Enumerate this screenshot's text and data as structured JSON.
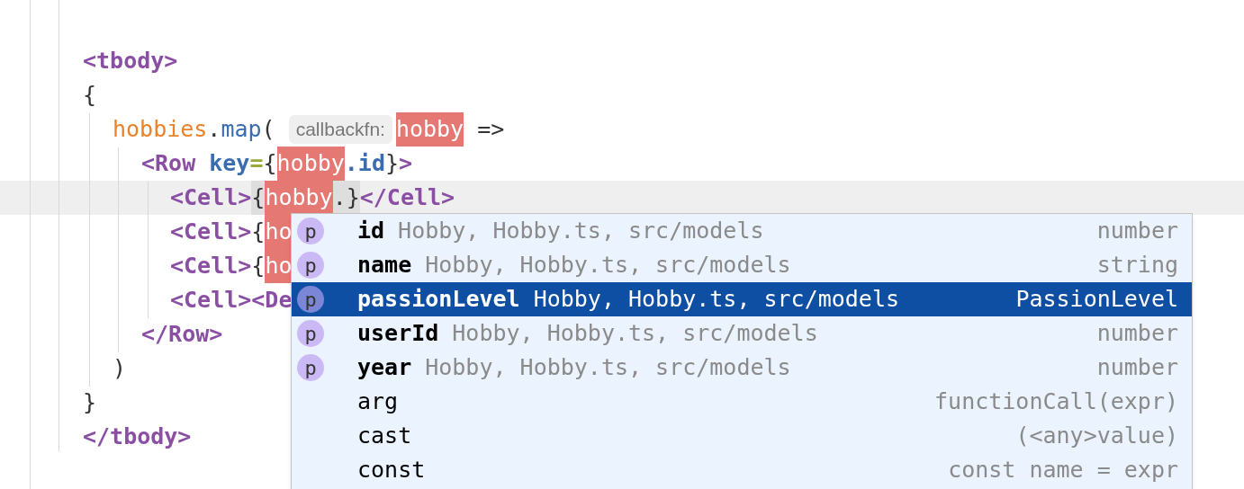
{
  "code_lines": [
    {
      "current": false,
      "tokens": [
        {
          "kind": "tag",
          "text": "<tbody>"
        }
      ]
    },
    {
      "current": false,
      "tokens": [
        {
          "kind": "punct",
          "text": "{"
        }
      ],
      "children": [
        {
          "current": false,
          "tokens": [
            {
              "kind": "variable",
              "text": "hobbies"
            },
            {
              "kind": "punct",
              "text": "."
            },
            {
              "kind": "method",
              "text": "map"
            },
            {
              "kind": "punct",
              "text": "( "
            },
            {
              "kind": "hint",
              "text": "callbackfn:"
            },
            {
              "kind": "match",
              "text": "hobby"
            },
            {
              "kind": "punct",
              "text": " =>"
            }
          ],
          "children": [
            {
              "current": false,
              "tokens": [
                {
                  "kind": "tag",
                  "text": "<Row "
                },
                {
                  "kind": "attr",
                  "text": "key"
                },
                {
                  "kind": "equals",
                  "text": "="
                },
                {
                  "kind": "punct",
                  "text": "{"
                },
                {
                  "kind": "match",
                  "text": "hobby"
                },
                {
                  "kind": "property",
                  "text": ".id"
                },
                {
                  "kind": "punct",
                  "text": "}"
                },
                {
                  "kind": "tag",
                  "text": ">"
                }
              ],
              "children": [
                {
                  "current": true,
                  "tokens": [
                    {
                      "kind": "tag",
                      "text": "<Cell>"
                    },
                    {
                      "kind": "brace",
                      "text": "{"
                    },
                    {
                      "kind": "match",
                      "text": "hobby"
                    },
                    {
                      "kind": "brace",
                      "text": ".}"
                    },
                    {
                      "kind": "tag",
                      "text": "</Cell>"
                    }
                  ]
                },
                {
                  "current": false,
                  "tokens": [
                    {
                      "kind": "tag",
                      "text": "<Cell>"
                    },
                    {
                      "kind": "punct",
                      "text": "{"
                    },
                    {
                      "kind": "match",
                      "text": "ho"
                    }
                  ]
                },
                {
                  "current": false,
                  "tokens": [
                    {
                      "kind": "tag",
                      "text": "<Cell>"
                    },
                    {
                      "kind": "punct",
                      "text": "{"
                    },
                    {
                      "kind": "match",
                      "text": "ho"
                    }
                  ]
                },
                {
                  "current": false,
                  "tokens": [
                    {
                      "kind": "tag",
                      "text": "<Cell><De"
                    }
                  ]
                }
              ]
            },
            {
              "current": false,
              "tokens": [
                {
                  "kind": "tag",
                  "text": "</Row>"
                }
              ]
            }
          ]
        },
        {
          "current": false,
          "tokens": [
            {
              "kind": "punct",
              "text": ")"
            }
          ]
        }
      ]
    },
    {
      "current": false,
      "tokens": [
        {
          "kind": "punct",
          "text": "}"
        }
      ]
    },
    {
      "current": false,
      "tokens": [
        {
          "kind": "tag",
          "text": "</tbody>"
        }
      ]
    }
  ],
  "completion_popup": {
    "items": [
      {
        "kind": "property",
        "icon": "p",
        "name": "id",
        "detail": "Hobby, Hobby.ts, src/models",
        "type": "number",
        "selected": false
      },
      {
        "kind": "property",
        "icon": "p",
        "name": "name",
        "detail": "Hobby, Hobby.ts, src/models",
        "type": "string",
        "selected": false
      },
      {
        "kind": "property",
        "icon": "p",
        "name": "passionLevel",
        "detail": "Hobby, Hobby.ts, src/models",
        "type": "PassionLevel",
        "selected": true
      },
      {
        "kind": "property",
        "icon": "p",
        "name": "userId",
        "detail": "Hobby, Hobby.ts, src/models",
        "type": "number",
        "selected": false
      },
      {
        "kind": "property",
        "icon": "p",
        "name": "year",
        "detail": "Hobby, Hobby.ts, src/models",
        "type": "number",
        "selected": false
      },
      {
        "kind": "template",
        "name": "arg",
        "type": "functionCall(expr)",
        "selected": false
      },
      {
        "kind": "template",
        "name": "cast",
        "type": "(<any>value)",
        "selected": false
      },
      {
        "kind": "template",
        "name": "const",
        "type": "const name = expr",
        "selected": false
      }
    ]
  }
}
